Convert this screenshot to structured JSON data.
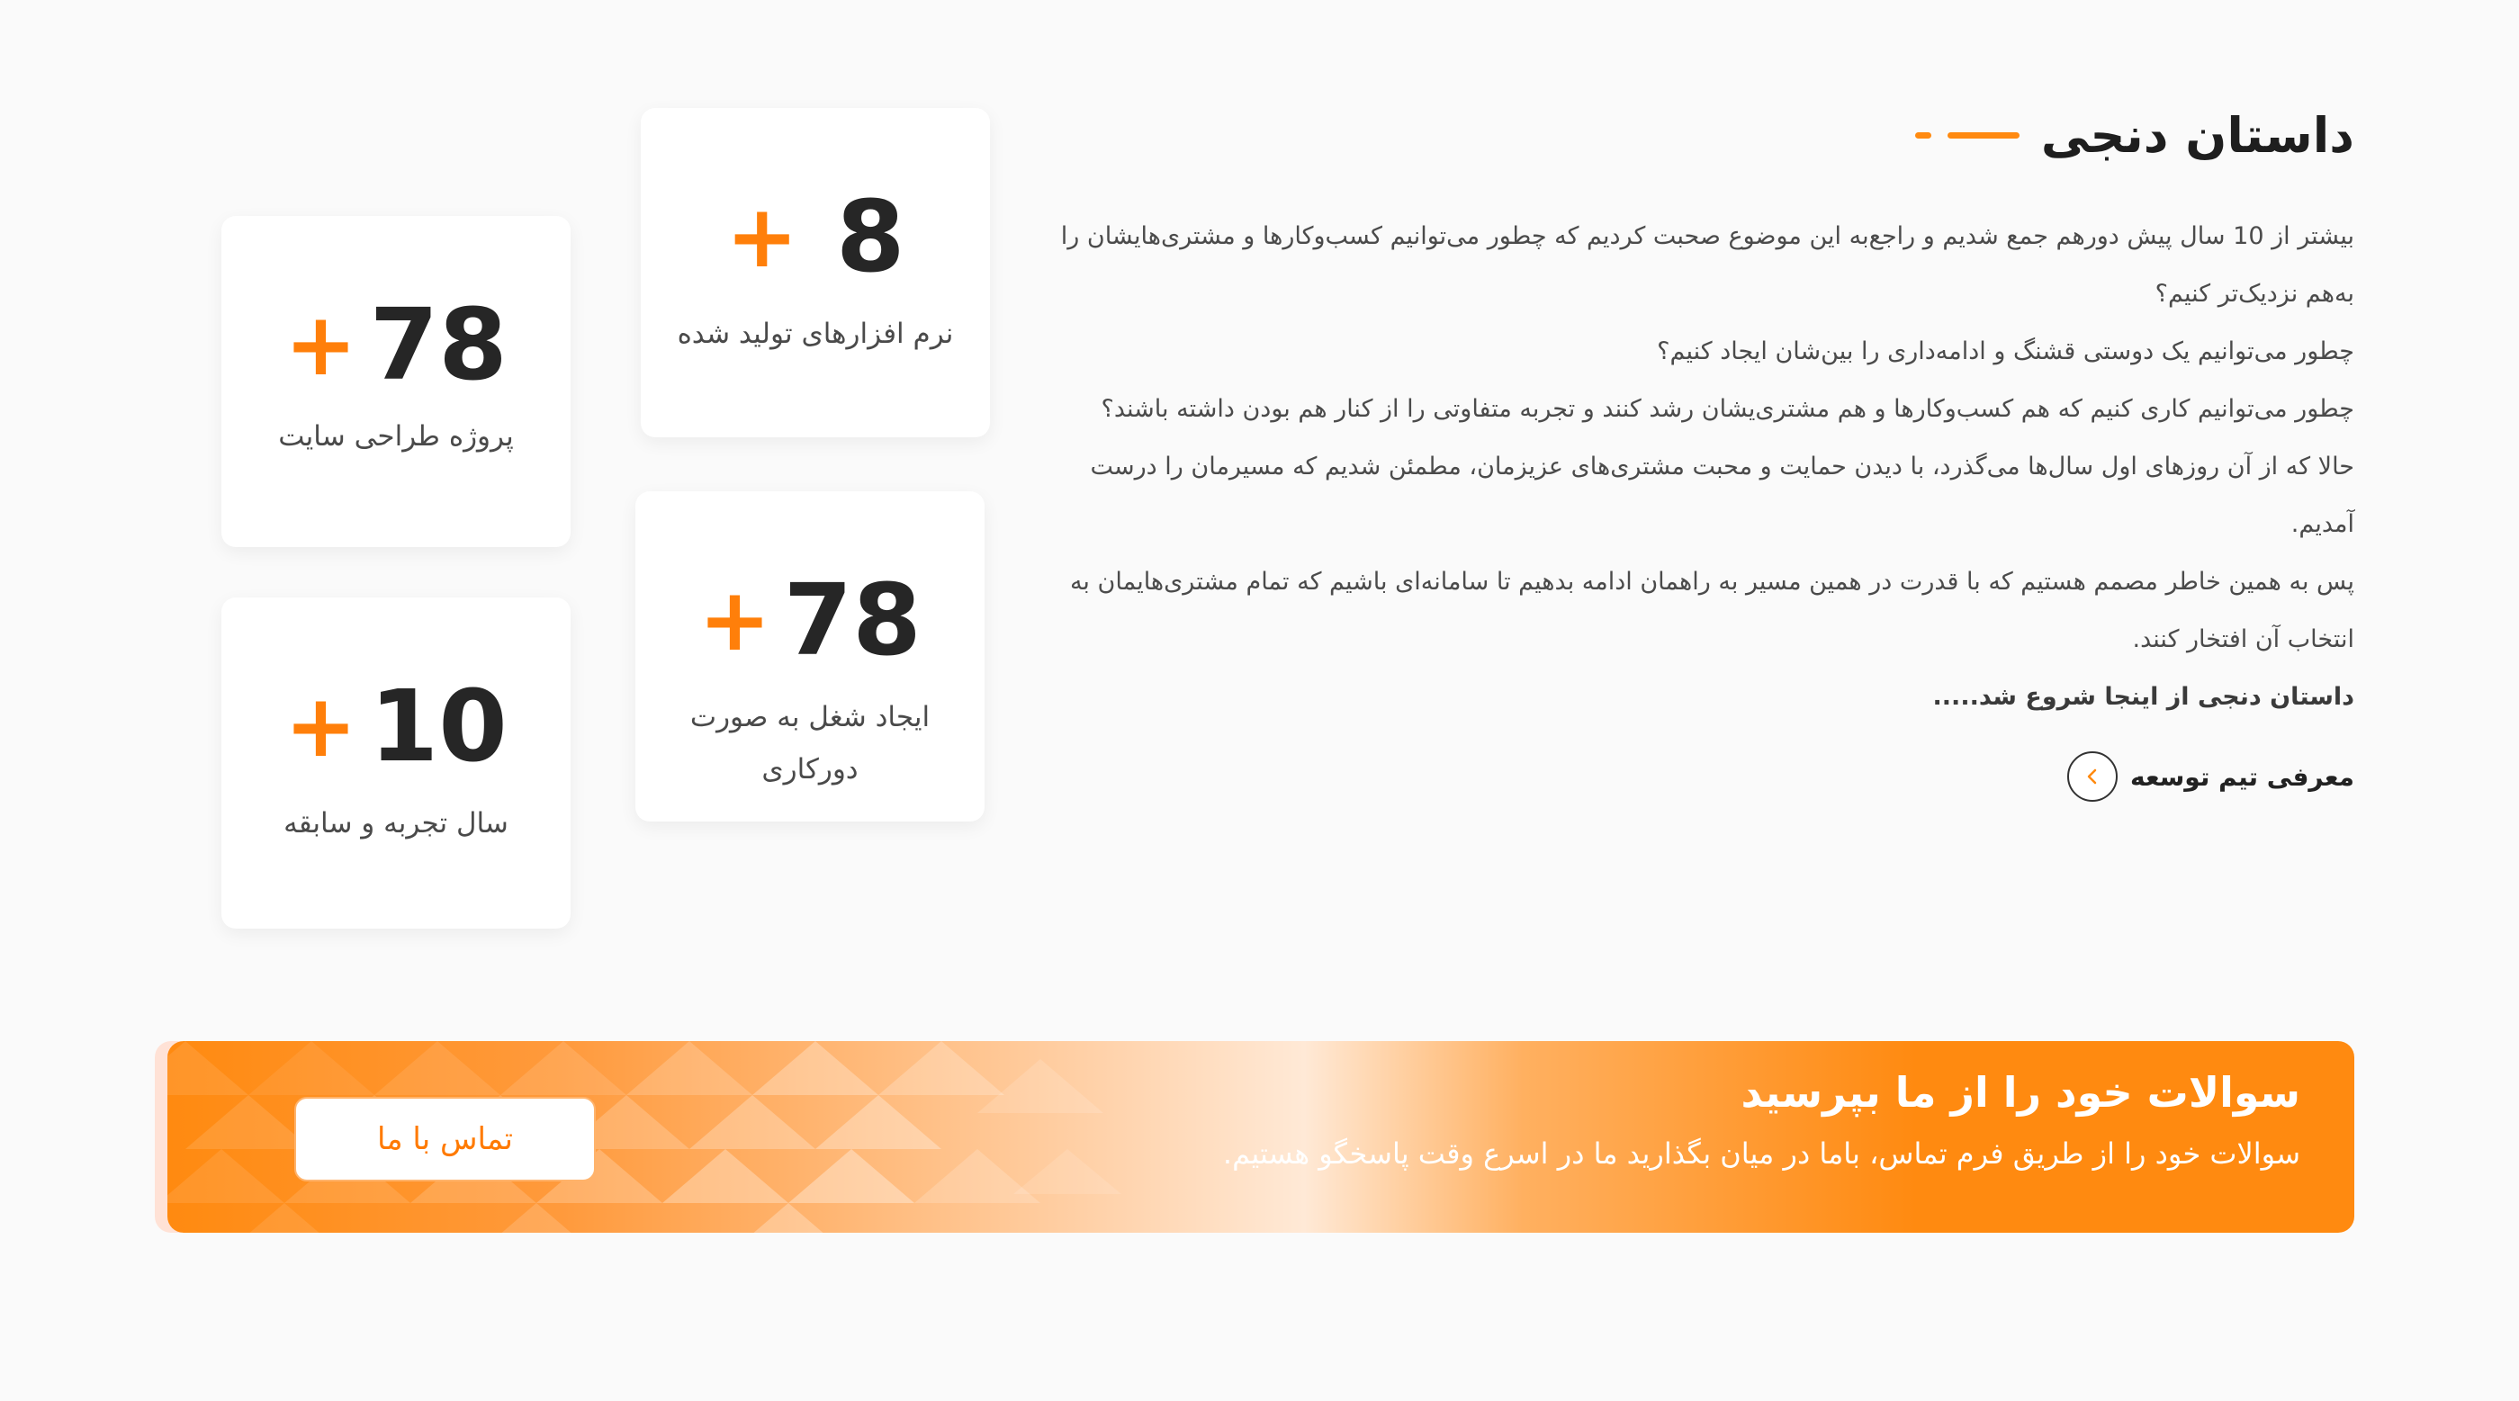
{
  "story": {
    "title": "داستان دنجی",
    "paragraphs": [
      "بیشتر از 10 سال پیش دورهم جمع شدیم و راجع‌به این موضوع صحبت کردیم که چطور می‌توانیم کسب‌وکارها و مشتری‌هایشان را به‌هم نزدیک‌تر کنیم؟",
      "چطور می‌توانیم یک دوستی قشنگ و ادامه‌داری را بین‌شان ایجاد کنیم؟",
      "چطور می‌توانیم کاری کنیم که هم کسب‌وکارها و هم مشتری‌یشان رشد کنند و تجربه متفاوتی را از کنار هم بودن داشته باشند؟",
      "حالا که از آن روزهای اول سال‌ها می‌گذرد، با دیدن حمایت و محبت مشتری‌های عزیزمان، مطمئن شدیم که مسیرمان را درست آمدیم.",
      "پس به همین خاطر مصمم هستیم که با قدرت در همین مسیر به راهمان ادامه بدهیم تا سامانه‌ای باشیم که تمام مشتری‌هایمان به انتخاب آن افتخار کنند."
    ],
    "closing": "داستان دنجی از اینجا شروع شد.....",
    "team_link": "معرفی تیم توسعه"
  },
  "stats": {
    "software": {
      "number": "8",
      "plus": "+",
      "label": "نرم افزارهای تولید شده"
    },
    "sites": {
      "number": "78",
      "plus": "+",
      "label": "پروژه طراحی سایت"
    },
    "remote_jobs": {
      "number": "78",
      "plus": "+",
      "label": "ایجاد شغل به صورت دورکاری"
    },
    "experience": {
      "number": "10",
      "plus": "+",
      "label": "سال تجربه و سابقه"
    }
  },
  "banner": {
    "title": "سوالات خود را از ما بپرسید",
    "subtitle": "سوالات خود را از طریق فرم تماس، باما در میان بگذارید ما در اسرع وقت پاسخگو هستیم.",
    "button": "تماس با ما"
  },
  "colors": {
    "accent": "#ff8a10",
    "text": "#222222",
    "background": "#fafafa"
  },
  "icons": {
    "team_link": "chevron-left-icon"
  }
}
